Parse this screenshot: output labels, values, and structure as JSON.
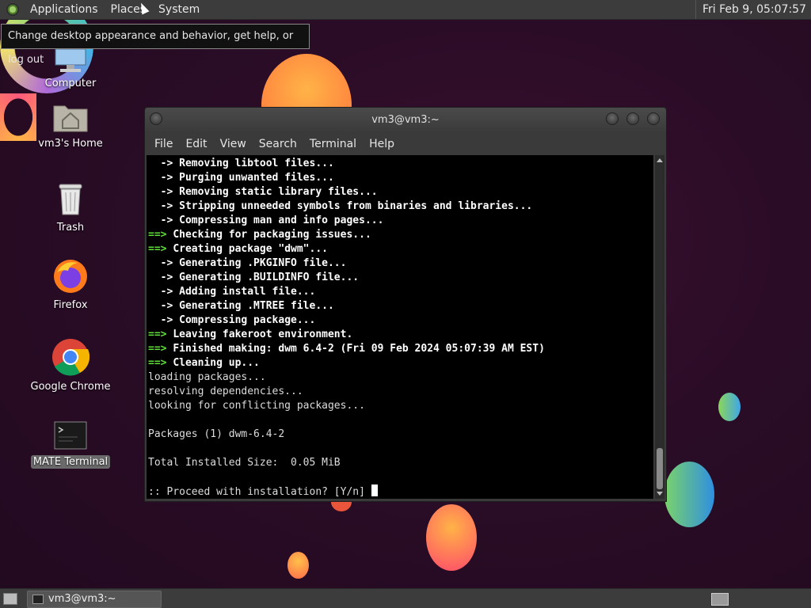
{
  "top_panel": {
    "menus": [
      "Applications",
      "Places",
      "System"
    ],
    "clock": "Fri Feb  9, 05:07:57"
  },
  "tooltip": "Change desktop appearance and behavior, get help, or log out",
  "desktop_icons": {
    "computer": "Computer",
    "home": "vm3's Home",
    "trash": "Trash",
    "firefox": "Firefox",
    "chrome": "Google Chrome",
    "terminal": "MATE Terminal"
  },
  "terminal": {
    "title": "vm3@vm3:~",
    "menus": [
      "File",
      "Edit",
      "View",
      "Search",
      "Terminal",
      "Help"
    ],
    "lines": [
      {
        "prefix": "  -> ",
        "text": "Removing libtool files...",
        "style": "arrow"
      },
      {
        "prefix": "  -> ",
        "text": "Purging unwanted files...",
        "style": "arrow"
      },
      {
        "prefix": "  -> ",
        "text": "Removing static library files...",
        "style": "arrow"
      },
      {
        "prefix": "  -> ",
        "text": "Stripping unneeded symbols from binaries and libraries...",
        "style": "arrow"
      },
      {
        "prefix": "  -> ",
        "text": "Compressing man and info pages...",
        "style": "arrow"
      },
      {
        "prefix": "==> ",
        "text": "Checking for packaging issues...",
        "style": "step"
      },
      {
        "prefix": "==> ",
        "text": "Creating package \"dwm\"...",
        "style": "step"
      },
      {
        "prefix": "  -> ",
        "text": "Generating .PKGINFO file...",
        "style": "arrow"
      },
      {
        "prefix": "  -> ",
        "text": "Generating .BUILDINFO file...",
        "style": "arrow"
      },
      {
        "prefix": "  -> ",
        "text": "Adding install file...",
        "style": "arrow"
      },
      {
        "prefix": "  -> ",
        "text": "Generating .MTREE file...",
        "style": "arrow"
      },
      {
        "prefix": "  -> ",
        "text": "Compressing package...",
        "style": "arrow"
      },
      {
        "prefix": "==> ",
        "text": "Leaving fakeroot environment.",
        "style": "step"
      },
      {
        "prefix": "==> ",
        "text": "Finished making: dwm 6.4-2 (Fri 09 Feb 2024 05:07:39 AM EST)",
        "style": "step"
      },
      {
        "prefix": "==> ",
        "text": "Cleaning up...",
        "style": "step"
      },
      {
        "prefix": "",
        "text": "loading packages...",
        "style": "plain"
      },
      {
        "prefix": "",
        "text": "resolving dependencies...",
        "style": "plain"
      },
      {
        "prefix": "",
        "text": "looking for conflicting packages...",
        "style": "plain"
      },
      {
        "prefix": "",
        "text": "",
        "style": "plain"
      },
      {
        "prefix": "",
        "text": "Packages (1) dwm-6.4-2",
        "style": "plain"
      },
      {
        "prefix": "",
        "text": "",
        "style": "plain"
      },
      {
        "prefix": "",
        "text": "Total Installed Size:  0.05 MiB",
        "style": "plain"
      },
      {
        "prefix": "",
        "text": "",
        "style": "plain"
      }
    ],
    "prompt": ":: Proceed with installation? [Y/n] "
  },
  "taskbar": {
    "task_label": "vm3@vm3:~"
  },
  "colors": {
    "wallpaper": "#2a0c26",
    "terminal_green": "#5fdf3a",
    "panel": "#3c3c3c"
  },
  "icons": [
    "mate-menu-icon",
    "computer-icon",
    "home-folder-icon",
    "trash-icon",
    "firefox-icon",
    "chrome-icon",
    "terminal-icon",
    "show-desktop-icon",
    "workspace-switcher-icon"
  ]
}
